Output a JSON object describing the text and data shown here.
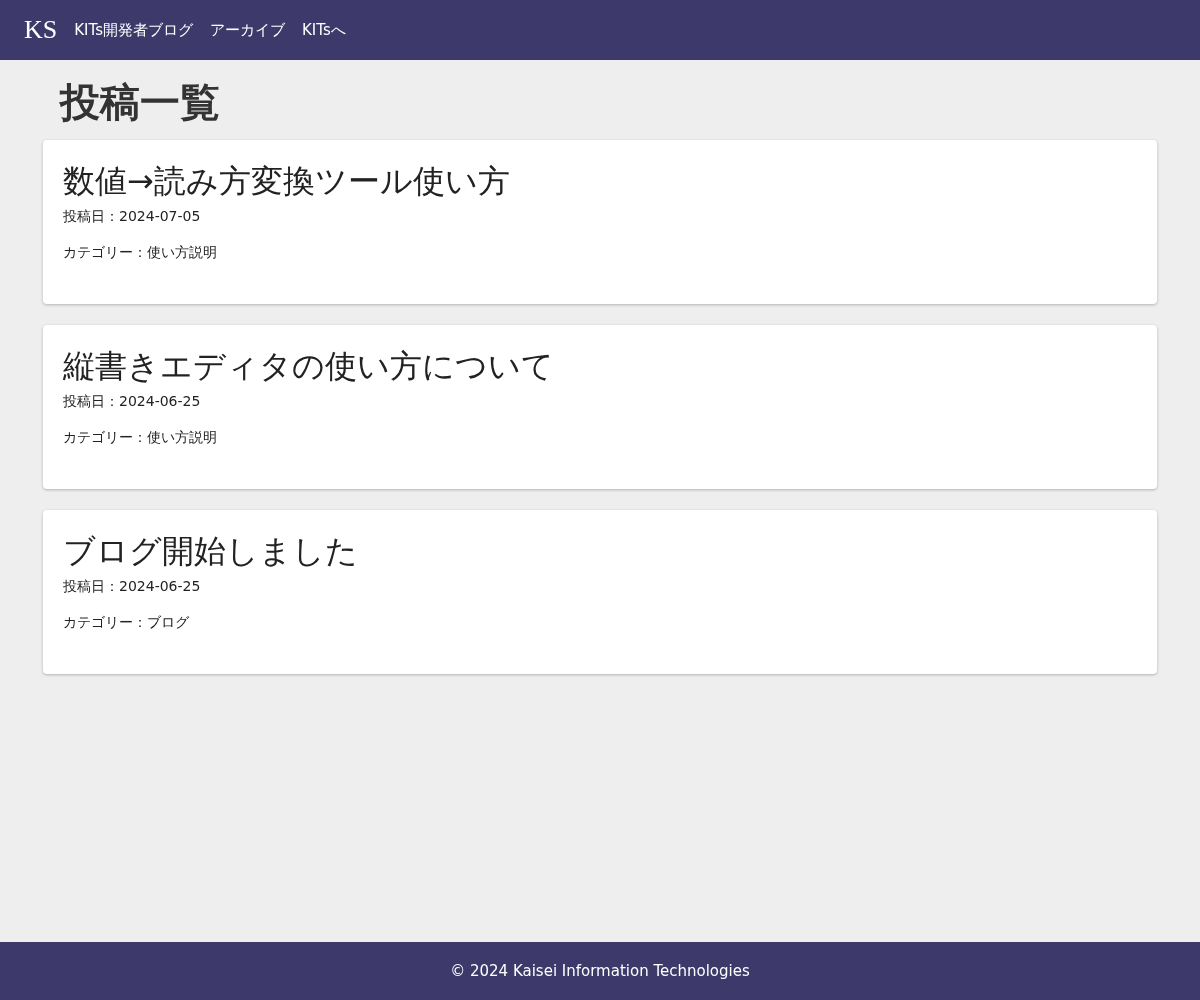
{
  "header": {
    "logo": "KS",
    "nav": [
      "KITs開発者ブログ",
      "アーカイブ",
      "KITsへ"
    ]
  },
  "page_title": "投稿一覧",
  "posts": [
    {
      "title": "数値→読み方変換ツール使い方",
      "date": "投稿日：2024-07-05",
      "category": "カテゴリー：使い方説明"
    },
    {
      "title": "縦書きエディタの使い方について",
      "date": "投稿日：2024-06-25",
      "category": "カテゴリー：使い方説明"
    },
    {
      "title": "ブログ開始しました",
      "date": "投稿日：2024-06-25",
      "category": "カテゴリー：ブログ"
    }
  ],
  "footer": "© 2024 Kaisei Information Technologies"
}
